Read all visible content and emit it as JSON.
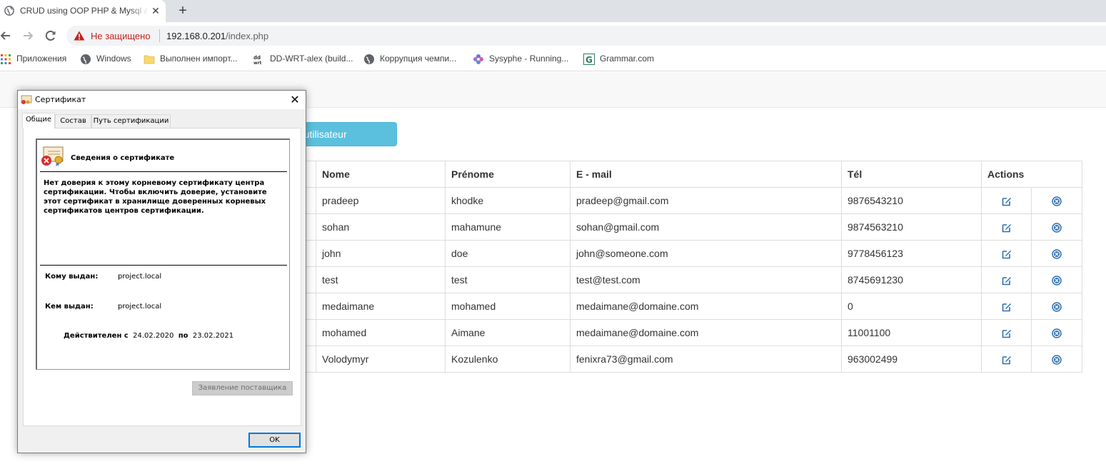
{
  "browser": {
    "tab_title": "CRUD using OOP PHP & Mysql & Bootstrap",
    "close_tab_glyph": "✕",
    "new_tab_glyph": "+",
    "security_label": "Не защищено",
    "url_host": "192.168.0.201",
    "url_path": "/index.php",
    "bookmarks": [
      {
        "label": "Приложения",
        "icon": "apps-grid-icon"
      },
      {
        "label": "Windows",
        "icon": "globe-icon"
      },
      {
        "label": "Выполнен импорт...",
        "icon": "folder-icon"
      },
      {
        "label": "DD-WRT-alex (build...",
        "icon": "dd-wrt-icon"
      },
      {
        "label": "Коррупция чемпи...",
        "icon": "globe-icon"
      },
      {
        "label": "Sysyphe - Running...",
        "icon": "flower-icon"
      },
      {
        "label": "Grammar.com",
        "icon": "grammar-g-icon"
      }
    ]
  },
  "page": {
    "add_button_label": "Ajouter un utilisateur",
    "table": {
      "headers": [
        "Nome",
        "Prénome",
        "E - mail",
        "Tél",
        "Actions"
      ],
      "rows": [
        {
          "nom": "pradeep",
          "prenom": "khodke",
          "email": "pradeep@gmail.com",
          "tel": "9876543210"
        },
        {
          "nom": "sohan",
          "prenom": "mahamune",
          "email": "sohan@gmail.com",
          "tel": "9874563210"
        },
        {
          "nom": "john",
          "prenom": "doe",
          "email": "john@someone.com",
          "tel": "9778456123"
        },
        {
          "nom": "test",
          "prenom": "test",
          "email": "test@test.com",
          "tel": "8745691230"
        },
        {
          "nom": "medaimane",
          "prenom": "mohamed",
          "email": "medaimane@domaine.com",
          "tel": "0"
        },
        {
          "nom": "mohamed",
          "prenom": "Aimane",
          "email": "medaimane@domaine.com",
          "tel": "11001100"
        },
        {
          "nom": "Volodymyr",
          "prenom": "Kozulenko",
          "email": "fenixra73@gmail.com",
          "tel": "963002499"
        }
      ],
      "action_icons": {
        "edit": "edit-icon",
        "delete": "delete-circle-icon"
      }
    }
  },
  "dialog": {
    "title": "Сертификат",
    "close_glyph": "✕",
    "tabs": [
      "Общие",
      "Состав",
      "Путь сертификации"
    ],
    "active_tab": "Общие",
    "info_title": "Сведения о сертификате",
    "warning_text": "Нет доверия к этому корневому сертификату центра сертификации. Чтобы включить доверие, установите этот сертификат в хранилище доверенных корневых сертификатов центров сертификации.",
    "issued_to_label": "Кому выдан:",
    "issued_to_value": "project.local",
    "issued_by_label": "Кем выдан:",
    "issued_by_value": "project.local",
    "valid_from_label": "Действителен с",
    "valid_from": "24.02.2020",
    "valid_to_label": "по",
    "valid_to": "23.02.2021",
    "issuer_statement_label": "Заявление поставщика",
    "ok_label": "OK"
  },
  "colors": {
    "accent_info": "#5bc0de",
    "action_icon": "#2f6fb0",
    "insecure_red": "#c5221f"
  }
}
